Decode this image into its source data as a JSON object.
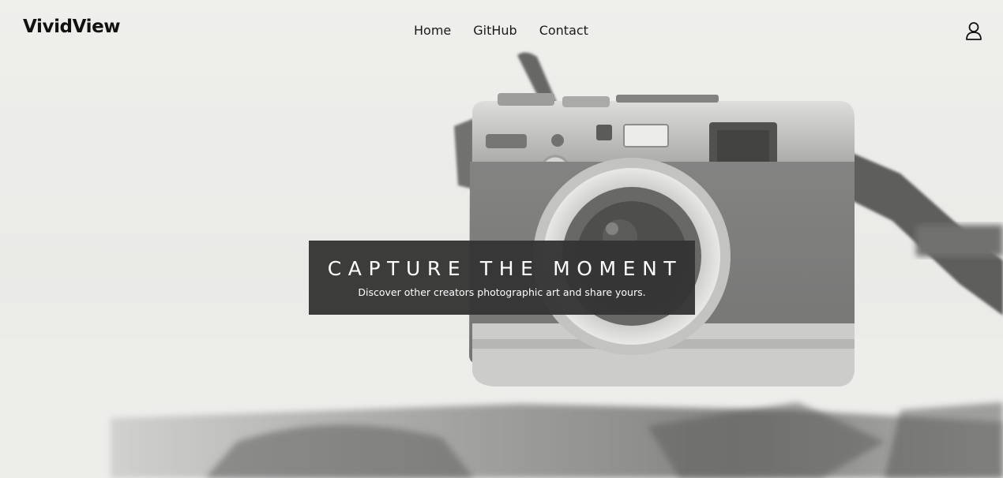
{
  "brand": {
    "name": "VividView"
  },
  "nav": {
    "items": [
      {
        "label": "Home"
      },
      {
        "label": "GitHub"
      },
      {
        "label": "Contact"
      }
    ],
    "account_icon": "user-outline-icon"
  },
  "hero": {
    "headline": "CAPTURE THE MOMENT",
    "subtitle": "Discover other creators photographic art and share yours.",
    "background_image": "camera-on-table-photo"
  },
  "colors": {
    "caption_bg": "#343434",
    "text_dark": "#111111",
    "text_light": "#ffffff"
  }
}
